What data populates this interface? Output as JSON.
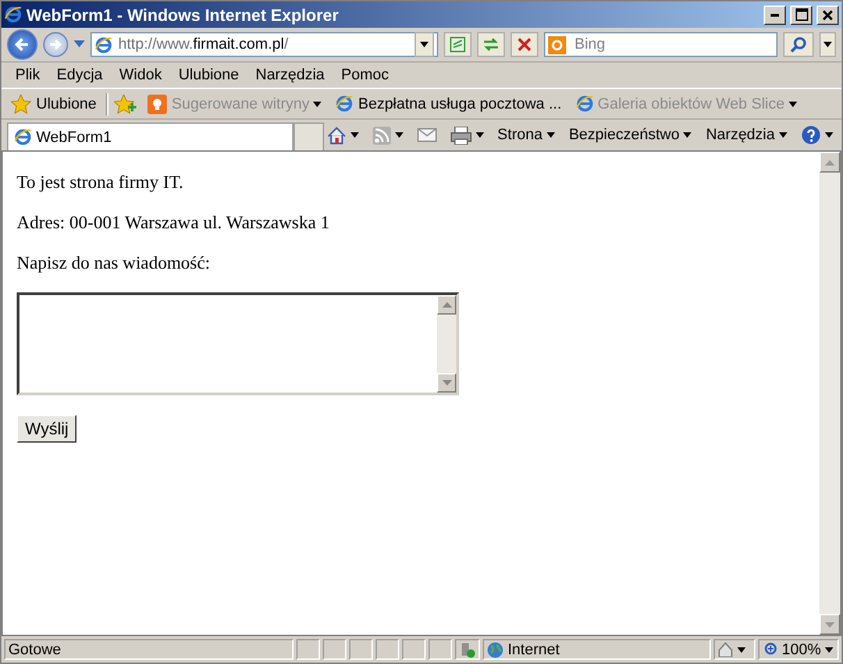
{
  "window": {
    "title": "WebForm1 - Windows Internet Explorer"
  },
  "address_bar": {
    "url_prefix": "http://www.",
    "url_domain": "firmait.com.pl",
    "url_suffix": "/"
  },
  "search": {
    "placeholder": "Bing"
  },
  "menu": [
    "Plik",
    "Edycja",
    "Widok",
    "Ulubione",
    "Narzędzia",
    "Pomoc"
  ],
  "favorites_bar": {
    "favorites_button": "Ulubione",
    "links": [
      {
        "label": "Sugerowane witryny",
        "disabled": true,
        "dropdown": true
      },
      {
        "label": "Bezpłatna usługa pocztowa ...",
        "disabled": false,
        "dropdown": false
      },
      {
        "label": "Galeria obiektów Web Slice",
        "disabled": true,
        "dropdown": true
      }
    ]
  },
  "tabs": [
    {
      "label": "WebForm1",
      "selected": true
    }
  ],
  "command_bar": [
    "Strona",
    "Bezpieczeństwo",
    "Narzędzia"
  ],
  "page": {
    "paragraphs": [
      "To jest strona firmy IT.",
      "Adres: 00-001 Warszawa ul. Warszawska 1",
      "Napisz do nas wiadomość:"
    ],
    "submit_button": "Wyślij"
  },
  "status_bar": {
    "text": "Gotowe",
    "zone": "Internet",
    "zoom": "100%"
  }
}
